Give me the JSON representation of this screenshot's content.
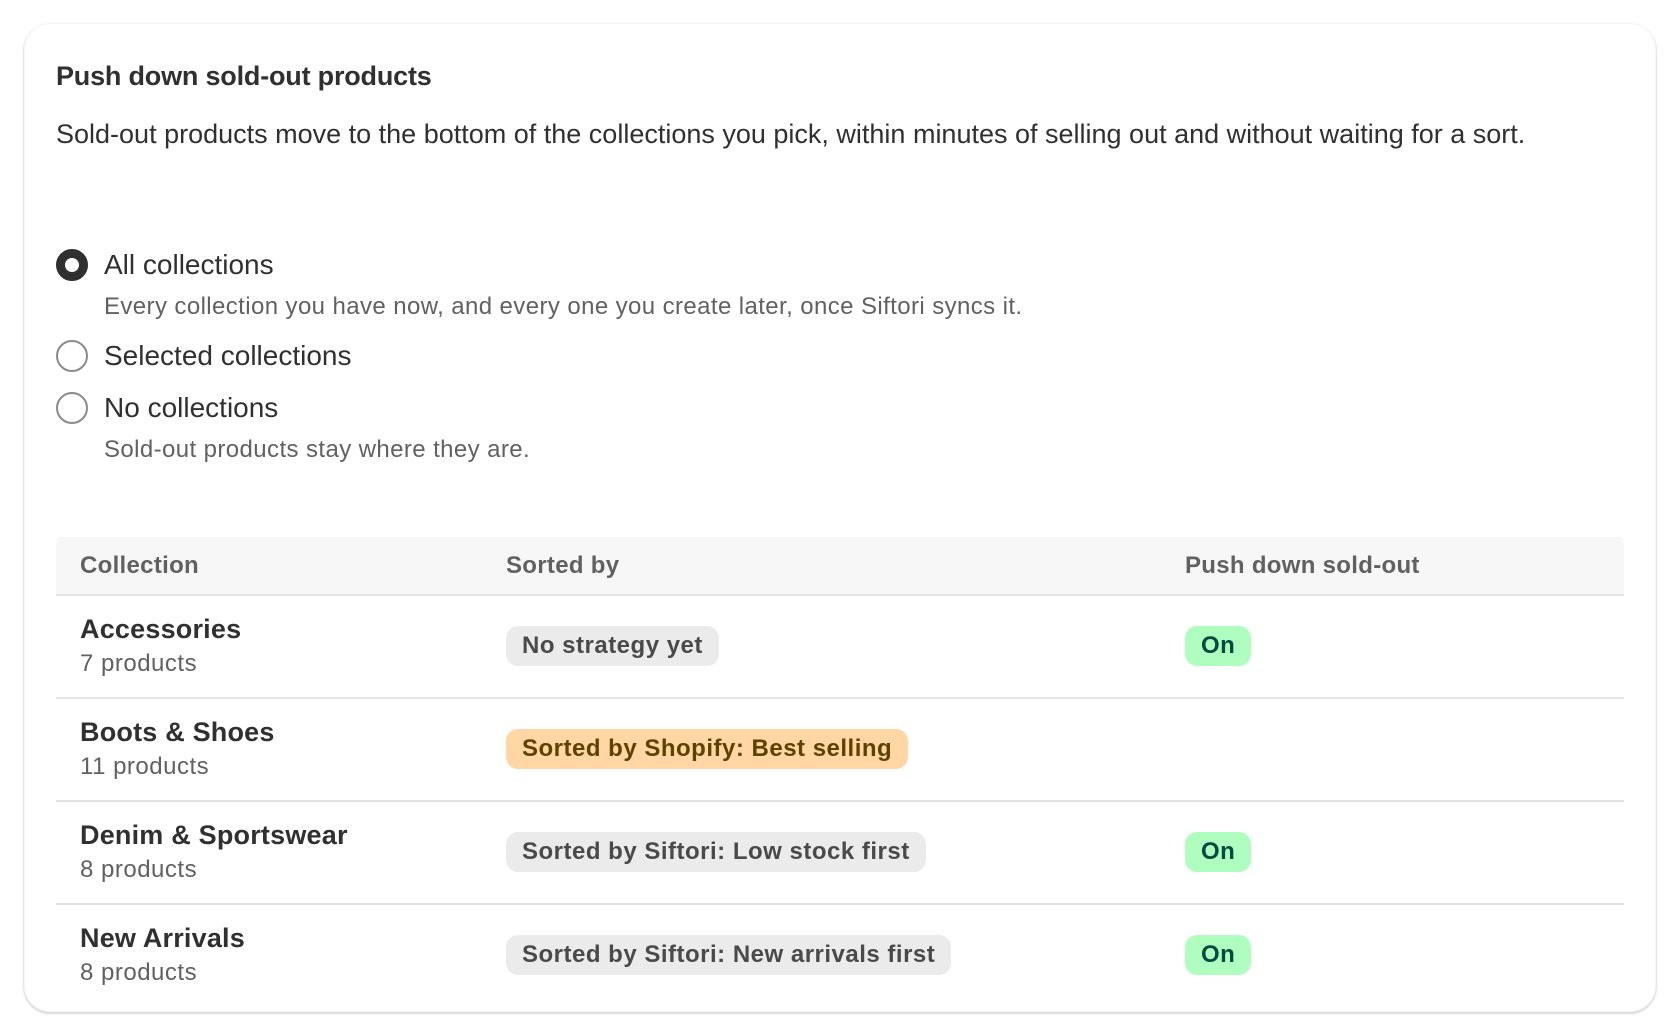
{
  "card": {
    "title": "Push down sold-out products",
    "description": "Sold-out products move to the bottom of the collections you pick, within minutes of selling out and without waiting for a sort."
  },
  "radio_options": [
    {
      "label": "All collections",
      "help": "Every collection you have now, and every one you create later, once Siftori syncs it.",
      "checked": true
    },
    {
      "label": "Selected collections",
      "help": "",
      "checked": false
    },
    {
      "label": "No collections",
      "help": "Sold-out products stay where they are.",
      "checked": false
    }
  ],
  "table": {
    "headers": [
      "Collection",
      "Sorted by",
      "Push down sold-out"
    ],
    "rows": [
      {
        "name": "Accessories",
        "count": "7 products",
        "sorted_by": "No strategy yet",
        "sorted_by_tone": "neutral",
        "push_down": "On"
      },
      {
        "name": "Boots & Shoes",
        "count": "11 products",
        "sorted_by": "Sorted by Shopify: Best selling",
        "sorted_by_tone": "warning",
        "push_down": ""
      },
      {
        "name": "Denim & Sportswear",
        "count": "8 products",
        "sorted_by": "Sorted by Siftori: Low stock first",
        "sorted_by_tone": "neutral",
        "push_down": "On"
      },
      {
        "name": "New Arrivals",
        "count": "8 products",
        "sorted_by": "Sorted by Siftori: New arrivals first",
        "sorted_by_tone": "neutral",
        "push_down": "On"
      }
    ]
  },
  "colors": {
    "badge_neutral": "#ebebeb",
    "badge_warning": "#ffd6a4",
    "badge_success": "#affebf",
    "radio_checked": "#303030"
  }
}
